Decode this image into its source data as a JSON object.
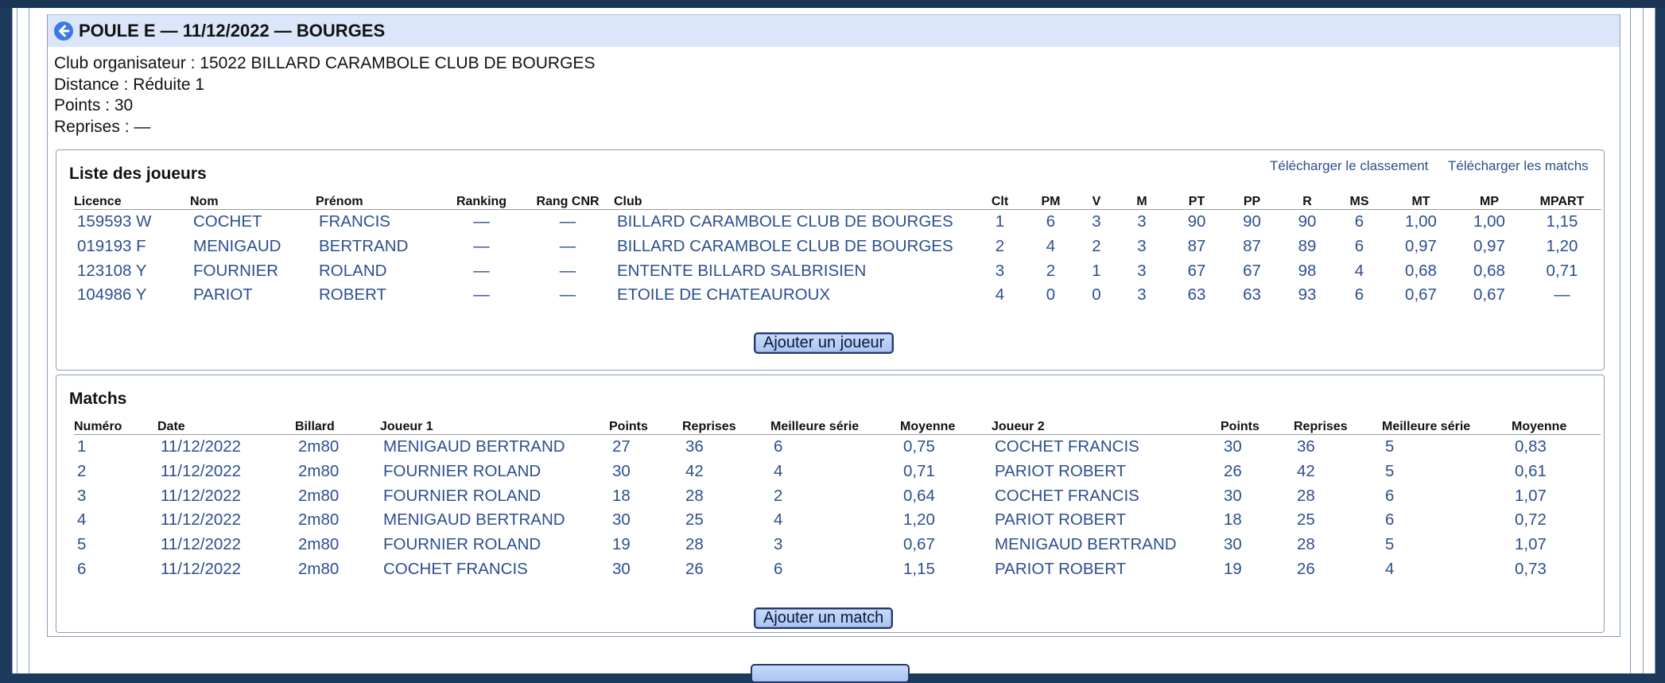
{
  "header": {
    "title": "POULE E — 11/12/2022 — BOURGES"
  },
  "info": {
    "club": "Club organisateur : 15022 BILLARD CARAMBOLE CLUB DE BOURGES",
    "distance": "Distance : Réduite 1",
    "points": "Points : 30",
    "reprises": "Reprises : —"
  },
  "players": {
    "title": "Liste des joueurs",
    "download_ranking": "Télécharger le classement",
    "download_matches": "Télécharger les matchs",
    "columns": [
      "Licence",
      "Nom",
      "Prénom",
      "Ranking",
      "Rang CNR",
      "Club",
      "Clt",
      "PM",
      "V",
      "M",
      "PT",
      "PP",
      "R",
      "MS",
      "MT",
      "MP",
      "MPART"
    ],
    "rows": [
      [
        "159593 W",
        "COCHET",
        "FRANCIS",
        "—",
        "—",
        "BILLARD CARAMBOLE CLUB DE BOURGES",
        "1",
        "6",
        "3",
        "3",
        "90",
        "90",
        "90",
        "6",
        "1,00",
        "1,00",
        "1,15"
      ],
      [
        "019193 F",
        "MENIGAUD",
        "BERTRAND",
        "—",
        "—",
        "BILLARD CARAMBOLE CLUB DE BOURGES",
        "2",
        "4",
        "2",
        "3",
        "87",
        "87",
        "89",
        "6",
        "0,97",
        "0,97",
        "1,20"
      ],
      [
        "123108 Y",
        "FOURNIER",
        "ROLAND",
        "—",
        "—",
        "ENTENTE BILLARD SALBRISIEN",
        "3",
        "2",
        "1",
        "3",
        "67",
        "67",
        "98",
        "4",
        "0,68",
        "0,68",
        "0,71"
      ],
      [
        "104986 Y",
        "PARIOT",
        "ROBERT",
        "—",
        "—",
        "ETOILE DE CHATEAUROUX",
        "4",
        "0",
        "0",
        "3",
        "63",
        "63",
        "93",
        "6",
        "0,67",
        "0,67",
        "—"
      ]
    ],
    "add_button": "Ajouter un joueur"
  },
  "matches": {
    "title": "Matchs",
    "columns": [
      "Numéro",
      "Date",
      "Billard",
      "Joueur 1",
      "Points",
      "Reprises",
      "Meilleure série",
      "Moyenne",
      "Joueur 2",
      "Points",
      "Reprises",
      "Meilleure série",
      "Moyenne"
    ],
    "rows": [
      [
        "1",
        "11/12/2022",
        "2m80",
        "MENIGAUD BERTRAND",
        "27",
        "36",
        "6",
        "0,75",
        "COCHET FRANCIS",
        "30",
        "36",
        "5",
        "0,83"
      ],
      [
        "2",
        "11/12/2022",
        "2m80",
        "FOURNIER ROLAND",
        "30",
        "42",
        "4",
        "0,71",
        "PARIOT ROBERT",
        "26",
        "42",
        "5",
        "0,61"
      ],
      [
        "3",
        "11/12/2022",
        "2m80",
        "FOURNIER ROLAND",
        "18",
        "28",
        "2",
        "0,64",
        "COCHET FRANCIS",
        "30",
        "28",
        "6",
        "1,07"
      ],
      [
        "4",
        "11/12/2022",
        "2m80",
        "MENIGAUD BERTRAND",
        "30",
        "25",
        "4",
        "1,20",
        "PARIOT ROBERT",
        "18",
        "25",
        "6",
        "0,72"
      ],
      [
        "5",
        "11/12/2022",
        "2m80",
        "FOURNIER ROLAND",
        "19",
        "28",
        "3",
        "0,67",
        "MENIGAUD BERTRAND",
        "30",
        "28",
        "5",
        "1,07"
      ],
      [
        "6",
        "11/12/2022",
        "2m80",
        "COCHET FRANCIS",
        "30",
        "26",
        "6",
        "1,15",
        "PARIOT ROBERT",
        "19",
        "26",
        "4",
        "0,73"
      ]
    ],
    "add_button": "Ajouter un match"
  },
  "colors": {
    "header_bg": "#dbe6fb",
    "link": "#2d4f8e",
    "button": "#b6cdf6",
    "page_bg": "#1c3a5c"
  },
  "icons": {
    "back": "arrow-left-circle-icon"
  }
}
